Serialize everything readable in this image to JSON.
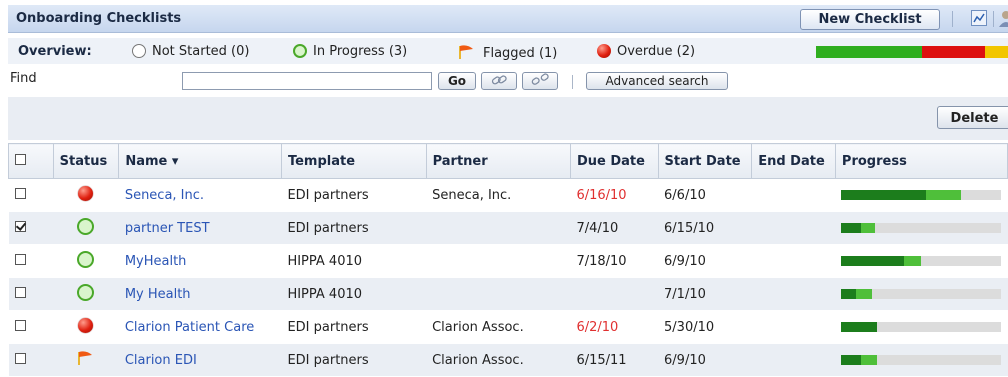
{
  "header": {
    "title": "Onboarding Checklists",
    "new_button": "New Checklist",
    "chart_icon": "chart-icon",
    "person_icon": "person-icon"
  },
  "overview": {
    "label": "Overview:",
    "not_started": "Not Started (0)",
    "in_progress": "In Progress (3)",
    "flagged": "Flagged (1)",
    "overdue": "Overdue (2)",
    "bar_fractions": {
      "green": 0.55,
      "red": 0.33,
      "yellow": 0.12
    },
    "colors": {
      "green": "#2fae1f",
      "red": "#dd1010",
      "yellow": "#f2c600"
    }
  },
  "find": {
    "label": "Find",
    "value": "",
    "go_label": "Go",
    "advanced_label": "Advanced search"
  },
  "toolbar": {
    "delete_label": "Delete"
  },
  "columns": [
    "Status",
    "Name ▾",
    "Template",
    "Partner",
    "Due Date",
    "Start Date",
    "End Date",
    "Progress"
  ],
  "rows": [
    {
      "checked": false,
      "status": "overdue",
      "name": "Seneca, Inc.",
      "template": "EDI partners",
      "partner": "Seneca, Inc.",
      "due": "6/16/10",
      "due_overdue": true,
      "start": "6/6/10",
      "end": "",
      "progress": 0.75,
      "progress_dark": 0.53
    },
    {
      "checked": true,
      "status": "in-progress",
      "name": "partner TEST",
      "template": "EDI partners",
      "partner": "",
      "due": "7/4/10",
      "due_overdue": false,
      "start": "6/15/10",
      "end": "",
      "progress": 0.21,
      "progress_dark": 0.12
    },
    {
      "checked": false,
      "status": "in-progress",
      "name": "MyHealth",
      "template": "HIPPA 4010",
      "partner": "",
      "due": "7/18/10",
      "due_overdue": false,
      "start": "6/9/10",
      "end": "",
      "progress": 0.5,
      "progress_dark": 0.39
    },
    {
      "checked": false,
      "status": "in-progress",
      "name": "My Health",
      "template": "HIPPA 4010",
      "partner": "",
      "due": "",
      "due_overdue": false,
      "start": "7/1/10",
      "end": "",
      "progress": 0.19,
      "progress_dark": 0.09
    },
    {
      "checked": false,
      "status": "overdue",
      "name": "Clarion Patient Care",
      "template": "EDI partners",
      "partner": "Clarion Assoc.",
      "due": "6/2/10",
      "due_overdue": true,
      "start": "5/30/10",
      "end": "",
      "progress": 0.22,
      "progress_dark": 0.22
    },
    {
      "checked": false,
      "status": "flagged",
      "name": "Clarion EDI",
      "template": "EDI partners",
      "partner": "Clarion Assoc.",
      "due": "6/15/11",
      "due_overdue": false,
      "start": "6/9/10",
      "end": "",
      "progress": 0.22,
      "progress_dark": 0.12
    }
  ]
}
